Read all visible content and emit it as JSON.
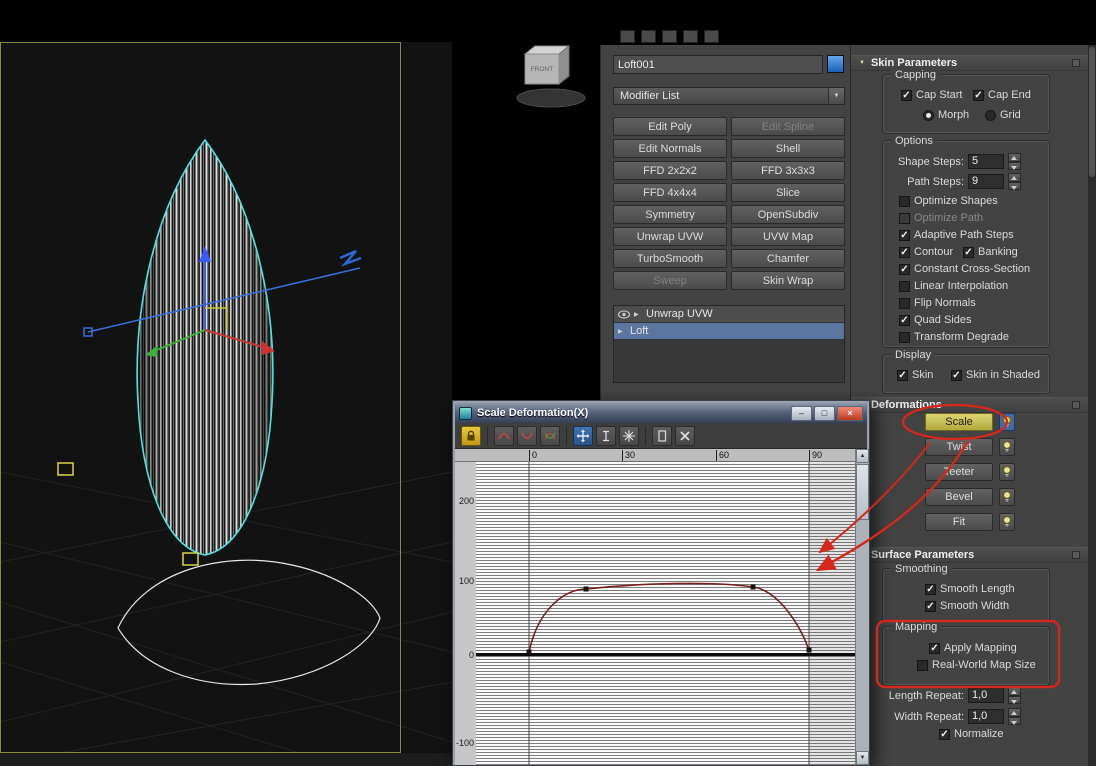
{
  "glyphs": {
    "dropdown": "▼",
    "stack_arrow": "▶",
    "rollout_arrow": "▼",
    "minimize": "–",
    "maximize": "□",
    "close": "×",
    "scroll_up": "▲",
    "scroll_down": "▼"
  },
  "colors": {
    "annotation_red": "#d2281e",
    "selection_blue": "#5d76a1",
    "object_swatch_blue": "#2b7cd4",
    "active_button_yellow": "#c9bf55",
    "viewport_outline_cyan": "#55e0e0"
  },
  "viewport": {
    "viewcube_label": "FRONT"
  },
  "panel": {
    "object_name": "Loft001",
    "modifier_list_label": "Modifier List",
    "buttons": [
      {
        "label": "Edit Poly",
        "enabled": true
      },
      {
        "label": "Edit Spline",
        "enabled": false
      },
      {
        "label": "Edit Normals",
        "enabled": true
      },
      {
        "label": "Shell",
        "enabled": true
      },
      {
        "label": "FFD 2x2x2",
        "enabled": true
      },
      {
        "label": "FFD 3x3x3",
        "enabled": true
      },
      {
        "label": "FFD 4x4x4",
        "enabled": true
      },
      {
        "label": "Slice",
        "enabled": true
      },
      {
        "label": "Symmetry",
        "enabled": true
      },
      {
        "label": "OpenSubdiv",
        "enabled": true
      },
      {
        "label": "Unwrap UVW",
        "enabled": true
      },
      {
        "label": "UVW Map",
        "enabled": true
      },
      {
        "label": "TurboSmooth",
        "enabled": true
      },
      {
        "label": "Chamfer",
        "enabled": true
      },
      {
        "label": "Sweep",
        "enabled": false
      },
      {
        "label": "Skin Wrap",
        "enabled": true
      }
    ],
    "stack": [
      {
        "label": "Unwrap UVW",
        "selected": false
      },
      {
        "label": "Loft",
        "selected": true
      }
    ]
  },
  "skin_parameters": {
    "title": "Skin Parameters",
    "capping": {
      "title": "Capping",
      "items": [
        {
          "label": "Cap Start",
          "checked": true
        },
        {
          "label": "Cap End",
          "checked": true
        }
      ],
      "radios": [
        {
          "label": "Morph",
          "selected": true
        },
        {
          "label": "Grid",
          "selected": false
        }
      ]
    },
    "options": {
      "title": "Options",
      "shape_steps_label": "Shape Steps:",
      "shape_steps_value": "5",
      "path_steps_label": "Path Steps:",
      "path_steps_value": "9",
      "checks": [
        {
          "label": "Optimize Shapes",
          "checked": false,
          "enabled": true
        },
        {
          "label": "Optimize Path",
          "checked": false,
          "enabled": false
        },
        {
          "label": "Adaptive Path Steps",
          "checked": true,
          "enabled": true
        },
        {
          "label": "Contour",
          "checked": true,
          "enabled": true
        },
        {
          "label": "Banking",
          "checked": true,
          "enabled": true
        },
        {
          "label": "Constant Cross-Section",
          "checked": true,
          "enabled": true
        },
        {
          "label": "Linear Interpolation",
          "checked": false,
          "enabled": true
        },
        {
          "label": "Flip Normals",
          "checked": false,
          "enabled": true
        },
        {
          "label": "Quad Sides",
          "checked": true,
          "enabled": true
        },
        {
          "label": "Transform Degrade",
          "checked": false,
          "enabled": true
        }
      ]
    },
    "display": {
      "title": "Display",
      "items": [
        {
          "label": "Skin",
          "checked": true
        },
        {
          "label": "Skin in Shaded",
          "checked": true
        }
      ]
    }
  },
  "deformations": {
    "title": "Deformations",
    "buttons": [
      {
        "label": "Scale",
        "active": true
      },
      {
        "label": "Twist",
        "active": false
      },
      {
        "label": "Teeter",
        "active": false
      },
      {
        "label": "Bevel",
        "active": false
      },
      {
        "label": "Fit",
        "active": false
      }
    ]
  },
  "surface_parameters": {
    "title": "Surface Parameters",
    "smoothing": {
      "title": "Smoothing",
      "items": [
        {
          "label": "Smooth Length",
          "checked": true
        },
        {
          "label": "Smooth Width",
          "checked": true
        }
      ]
    },
    "mapping": {
      "title": "Mapping",
      "items": [
        {
          "label": "Apply Mapping",
          "checked": true
        },
        {
          "label": "Real-World Map Size",
          "checked": false
        }
      ]
    },
    "length_repeat_label": "Length Repeat:",
    "length_repeat_value": "1,0",
    "width_repeat_label": "Width Repeat:",
    "width_repeat_value": "1,0",
    "normalize": {
      "label": "Normalize",
      "checked": true
    }
  },
  "dialog": {
    "title": "Scale Deformation(X)",
    "ruler_labels": [
      "0",
      "30",
      "60",
      "90"
    ],
    "y_axis_labels": [
      "200",
      "100",
      "0",
      "-100"
    ],
    "curve_control_points": [
      {
        "path_percent": 0,
        "scale_value": 5
      },
      {
        "path_percent": 20,
        "scale_value": 89
      },
      {
        "path_percent": 79,
        "scale_value": 92
      },
      {
        "path_percent": 99,
        "scale_value": 7
      }
    ],
    "toolbar_icons": [
      "make-symmetrical",
      "display-x-axis",
      "display-y-axis",
      "display-xy-axes",
      "move-control-point",
      "scale-control-point",
      "insert-corner-point",
      "reset-curve",
      "delete-control-point"
    ]
  }
}
